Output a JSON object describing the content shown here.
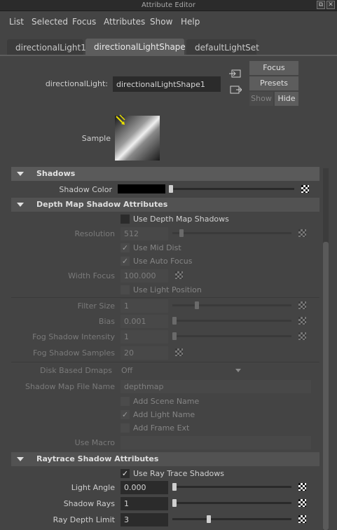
{
  "window": {
    "title": "Attribute Editor"
  },
  "menubar": {
    "items": [
      "List",
      "Selected",
      "Focus",
      "Attributes",
      "Show",
      "Help"
    ]
  },
  "tabs": [
    "directionalLight1",
    "directionalLightShape1",
    "defaultLightSet"
  ],
  "header": {
    "node_type_label": "directionalLight:",
    "node_name": "directionalLightShape1",
    "focus_label": "Focus",
    "presets_label": "Presets",
    "show_label": "Show",
    "hide_label": "Hide",
    "sample_label": "Sample"
  },
  "shadows": {
    "title": "Shadows",
    "shadow_color_label": "Shadow Color",
    "shadow_color": "#000000"
  },
  "depth_map": {
    "title": "Depth Map Shadow Attributes",
    "use_depth_map_label": "Use Depth Map Shadows",
    "use_depth_map": false,
    "resolution_label": "Resolution",
    "resolution": "512",
    "use_mid_dist_label": "Use Mid Dist",
    "use_mid_dist": true,
    "use_auto_focus_label": "Use Auto Focus",
    "use_auto_focus": true,
    "width_focus_label": "Width Focus",
    "width_focus": "100.000",
    "use_light_position_label": "Use Light Position",
    "use_light_position": false,
    "filter_size_label": "Filter Size",
    "filter_size": "1",
    "bias_label": "Bias",
    "bias": "0.001",
    "fog_intensity_label": "Fog Shadow Intensity",
    "fog_intensity": "1",
    "fog_samples_label": "Fog Shadow Samples",
    "fog_samples": "20",
    "disk_based_label": "Disk Based Dmaps",
    "disk_based": "Off",
    "file_name_label": "Shadow Map File Name",
    "file_name": "depthmap",
    "add_scene_name_label": "Add Scene Name",
    "add_scene_name": false,
    "add_light_name_label": "Add Light Name",
    "add_light_name": true,
    "add_frame_ext_label": "Add Frame Ext",
    "add_frame_ext": false,
    "use_macro_label": "Use Macro",
    "use_macro": ""
  },
  "raytrace": {
    "title": "Raytrace Shadow Attributes",
    "use_ray_trace_label": "Use Ray Trace Shadows",
    "use_ray_trace": true,
    "light_angle_label": "Light Angle",
    "light_angle": "0.000",
    "shadow_rays_label": "Shadow Rays",
    "shadow_rays": "1",
    "ray_depth_limit_label": "Ray Depth Limit",
    "ray_depth_limit": "3"
  }
}
